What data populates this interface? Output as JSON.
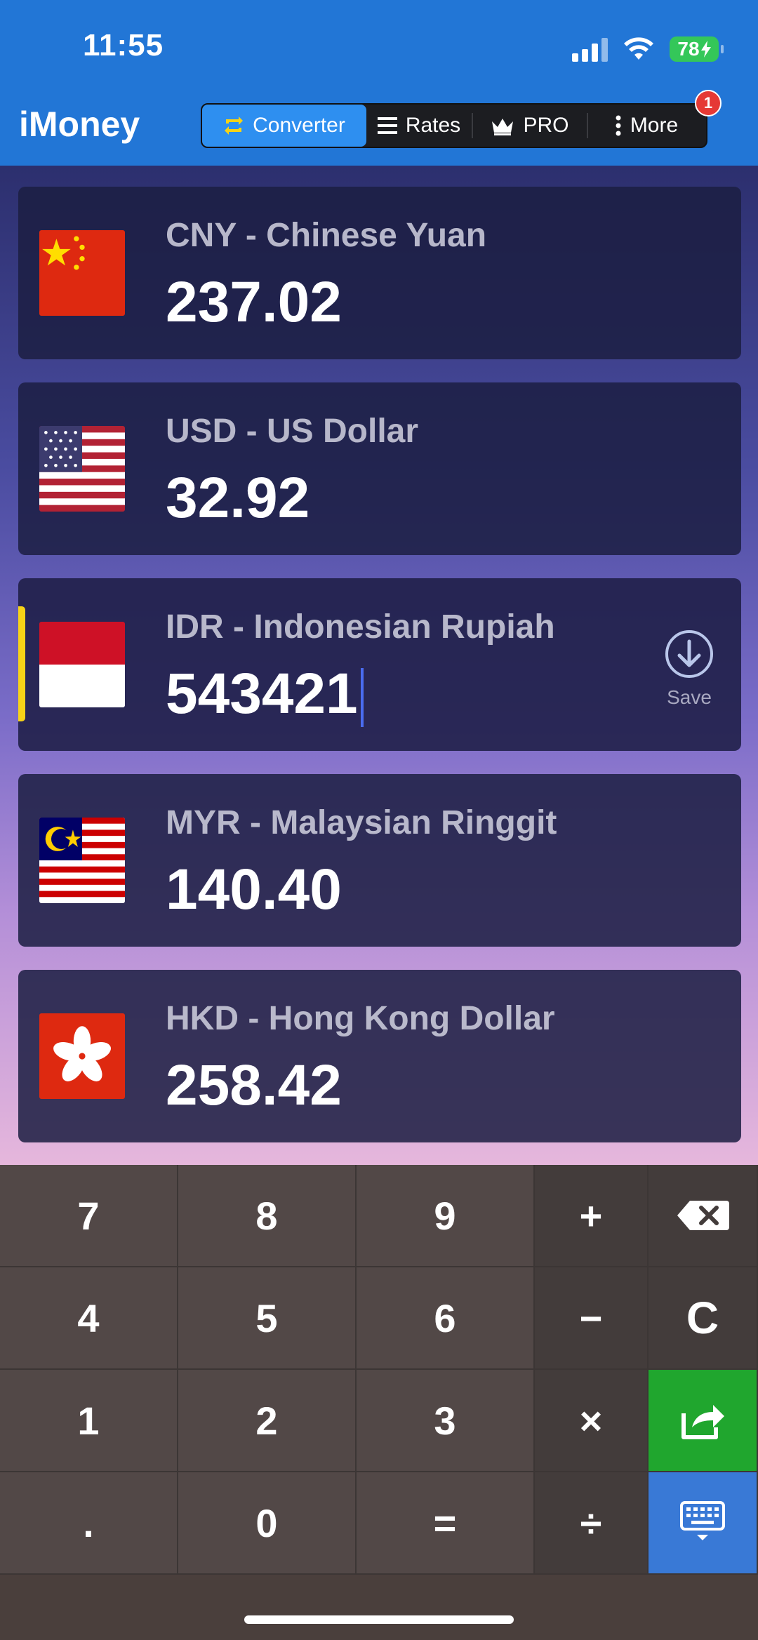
{
  "status_bar": {
    "time": "11:55",
    "battery": "78"
  },
  "app": {
    "title": "iMoney"
  },
  "nav": {
    "tabs": [
      {
        "label": "Converter",
        "icon": "swap-icon",
        "active": true
      },
      {
        "label": "Rates",
        "icon": "list-icon",
        "active": false
      },
      {
        "label": "PRO",
        "icon": "crown-icon",
        "active": false
      },
      {
        "label": "More",
        "icon": "more-vertical-icon",
        "active": false
      }
    ],
    "badge": "1"
  },
  "currencies": [
    {
      "code_name": "CNY - Chinese Yuan",
      "value": "237.02",
      "flag": "china-flag-icon"
    },
    {
      "code_name": "USD - US Dollar",
      "value": "32.92",
      "flag": "us-flag-icon"
    },
    {
      "code_name": "IDR - Indonesian Rupiah",
      "value": "543421",
      "flag": "indonesia-flag-icon",
      "selected": true
    },
    {
      "code_name": "MYR - Malaysian Ringgit",
      "value": "140.40",
      "flag": "malaysia-flag-icon"
    },
    {
      "code_name": "HKD - Hong Kong Dollar",
      "value": "258.42",
      "flag": "hongkong-flag-icon"
    }
  ],
  "save": {
    "label": "Save"
  },
  "keypad": {
    "keys": [
      [
        "7",
        "8",
        "9",
        "+",
        "backspace"
      ],
      [
        "4",
        "5",
        "6",
        "−",
        "C"
      ],
      [
        "1",
        "2",
        "3",
        "×",
        "share"
      ],
      [
        ".",
        "0",
        "=",
        "÷",
        "keyboard"
      ]
    ]
  },
  "colors": {
    "header": "#2276d6",
    "active_tab": "#2e8ff0",
    "selected_indicator": "#f7d317",
    "share_key": "#20a62e",
    "keyboard_key": "#3979d6"
  }
}
